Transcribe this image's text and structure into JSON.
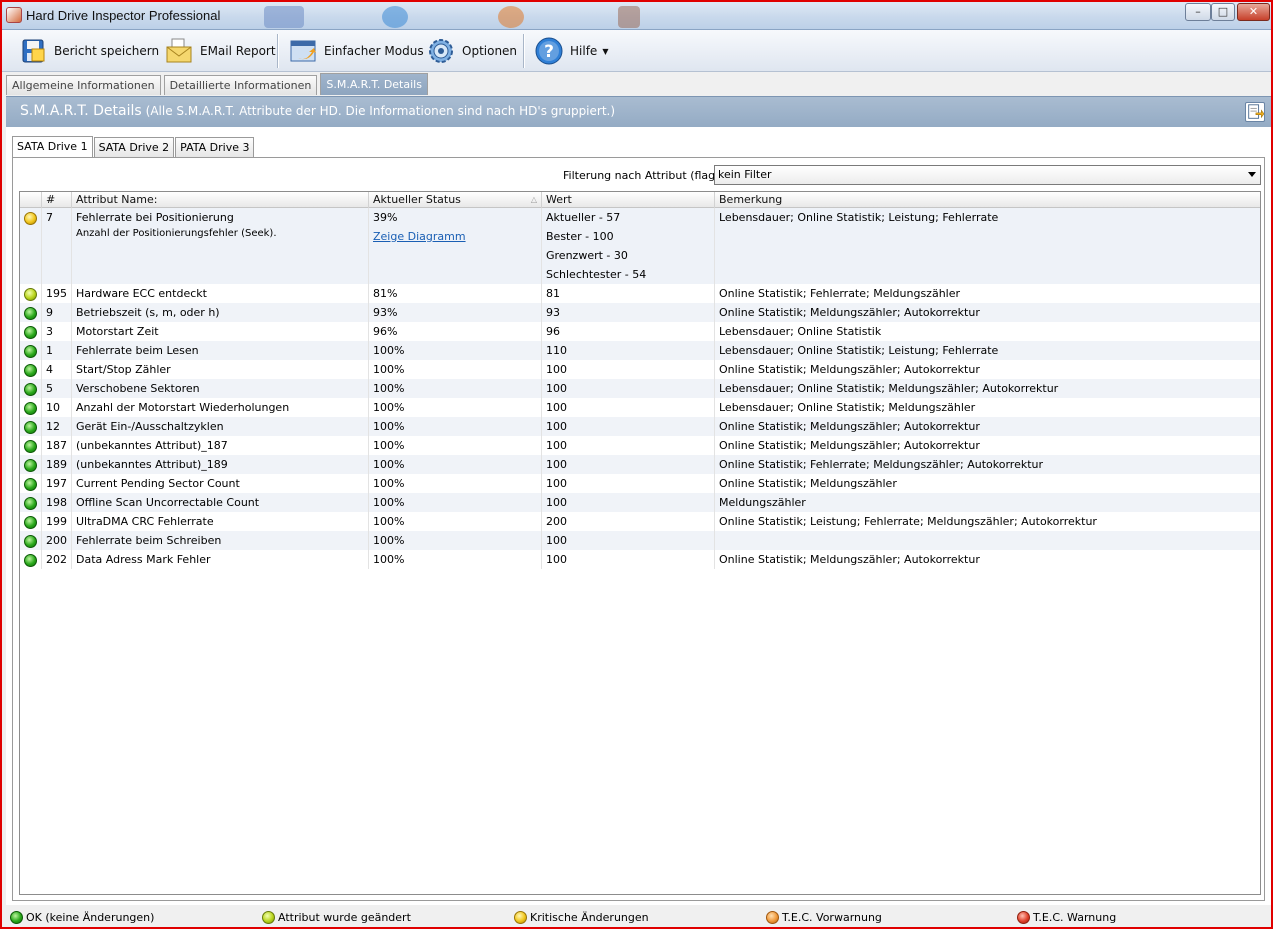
{
  "window": {
    "title": "Hard Drive Inspector Professional",
    "controls": {
      "minimize": "–",
      "maximize": "□",
      "close": "✕"
    }
  },
  "toolbar": {
    "save_label": "Bericht speichern",
    "email_label": "EMail Report",
    "simple_label": "Einfacher Modus",
    "options_label": "Optionen",
    "help_label": "Hilfe"
  },
  "main_tabs": [
    "Allgemeine Informationen",
    "Detaillierte Informationen",
    "S.M.A.R.T. Details"
  ],
  "banner": {
    "title": "S.M.A.R.T. Details",
    "subtitle": "(Alle S.M.A.R.T. Attribute der HD. Die Informationen sind nach HD's gruppiert.)"
  },
  "drive_tabs": [
    "SATA Drive 1",
    "SATA Drive 2",
    "PATA Drive 3"
  ],
  "filter": {
    "label": "Filterung nach Attribut (flag):",
    "value": "kein Filter"
  },
  "grid": {
    "columns": [
      "#",
      "Attribut Name:",
      "Aktueller Status",
      "Wert",
      "Bemerkung"
    ],
    "first_row": {
      "id": "7",
      "name": "Fehlerrate bei Positionierung",
      "name_sub": "Anzahl der Positionierungsfehler (Seek).",
      "status": "39%",
      "link": "Zeige Diagramm",
      "values": [
        "Aktueller - 57",
        "Bester - 100",
        "Grenzwert - 30",
        "Schlechtester - 54"
      ],
      "remark": "Lebensdauer; Online Statistik; Leistung; Fehlerrate",
      "color": "yellow"
    },
    "rows": [
      {
        "id": "195",
        "name": "Hardware ECC entdeckt",
        "status": "81%",
        "value": "81",
        "remark": "Online Statistik; Fehlerrate; Meldungszähler",
        "color": "yellowgreen"
      },
      {
        "id": "9",
        "name": "Betriebszeit (s, m, oder h)",
        "status": "93%",
        "value": "93",
        "remark": "Online Statistik; Meldungszähler; Autokorrektur",
        "color": "green"
      },
      {
        "id": "3",
        "name": "Motorstart Zeit",
        "status": "96%",
        "value": "96",
        "remark": "Lebensdauer; Online Statistik",
        "color": "green"
      },
      {
        "id": "1",
        "name": "Fehlerrate beim Lesen",
        "status": "100%",
        "value": "110",
        "remark": "Lebensdauer; Online Statistik; Leistung; Fehlerrate",
        "color": "green"
      },
      {
        "id": "4",
        "name": "Start/Stop Zähler",
        "status": "100%",
        "value": "100",
        "remark": "Online Statistik; Meldungszähler; Autokorrektur",
        "color": "green"
      },
      {
        "id": "5",
        "name": "Verschobene Sektoren",
        "status": "100%",
        "value": "100",
        "remark": "Lebensdauer; Online Statistik; Meldungszähler; Autokorrektur",
        "color": "green"
      },
      {
        "id": "10",
        "name": "Anzahl der Motorstart Wiederholungen",
        "status": "100%",
        "value": "100",
        "remark": "Lebensdauer; Online Statistik; Meldungszähler",
        "color": "green"
      },
      {
        "id": "12",
        "name": "Gerät Ein-/Ausschaltzyklen",
        "status": "100%",
        "value": "100",
        "remark": "Online Statistik; Meldungszähler; Autokorrektur",
        "color": "green"
      },
      {
        "id": "187",
        "name": "(unbekanntes Attribut)_187",
        "status": "100%",
        "value": "100",
        "remark": "Online Statistik; Meldungszähler; Autokorrektur",
        "color": "green"
      },
      {
        "id": "189",
        "name": "(unbekanntes Attribut)_189",
        "status": "100%",
        "value": "100",
        "remark": "Online Statistik; Fehlerrate; Meldungszähler; Autokorrektur",
        "color": "green"
      },
      {
        "id": "197",
        "name": "Current Pending Sector Count",
        "status": "100%",
        "value": "100",
        "remark": "Online Statistik; Meldungszähler",
        "color": "green"
      },
      {
        "id": "198",
        "name": "Offline Scan Uncorrectable Count",
        "status": "100%",
        "value": "100",
        "remark": "Meldungszähler",
        "color": "green"
      },
      {
        "id": "199",
        "name": "UltraDMA CRC Fehlerrate",
        "status": "100%",
        "value": "200",
        "remark": "Online Statistik; Leistung; Fehlerrate; Meldungszähler; Autokorrektur",
        "color": "green"
      },
      {
        "id": "200",
        "name": "Fehlerrate beim Schreiben",
        "status": "100%",
        "value": "100",
        "remark": "",
        "color": "green"
      },
      {
        "id": "202",
        "name": "Data Adress Mark Fehler",
        "status": "100%",
        "value": "100",
        "remark": "Online Statistik; Meldungszähler; Autokorrektur",
        "color": "green"
      }
    ]
  },
  "legend": [
    {
      "label": "OK (keine Änderungen)",
      "color": "green"
    },
    {
      "label": "Attribut wurde geändert",
      "color": "yellowgreen"
    },
    {
      "label": "Kritische Änderungen",
      "color": "yellow"
    },
    {
      "label": "T.E.C. Vorwarnung",
      "color": "orange"
    },
    {
      "label": "T.E.C. Warnung",
      "color": "red"
    }
  ]
}
